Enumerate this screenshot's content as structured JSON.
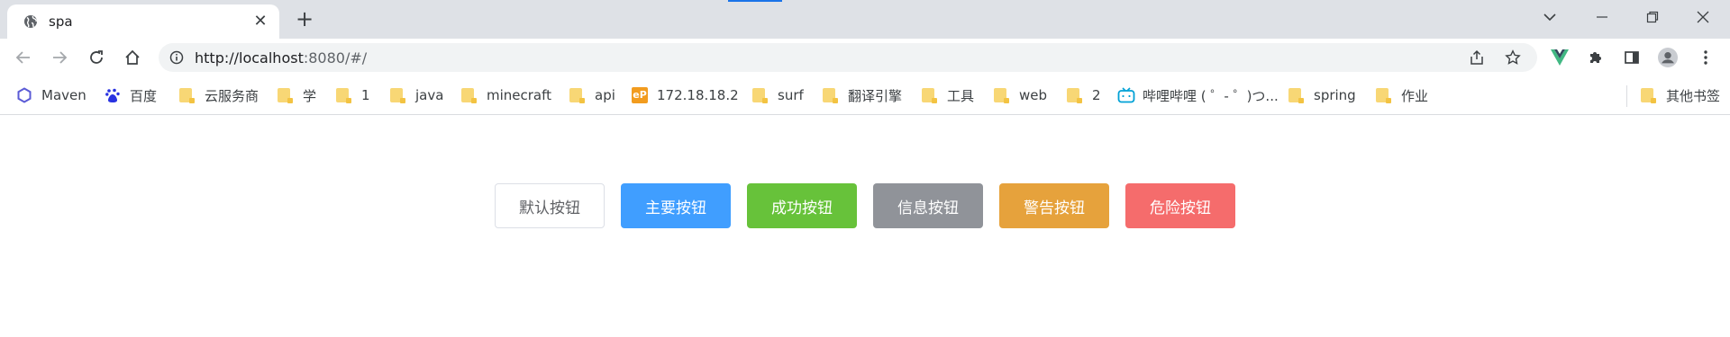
{
  "browser": {
    "tab": {
      "title": "spa",
      "close_glyph": "✕",
      "favicon": "globe-icon"
    },
    "new_tab_glyph": "+",
    "window_controls": [
      "chevron-down-icon",
      "minimize-icon",
      "restore-icon",
      "close-icon"
    ],
    "address": {
      "url_host": "http://localhost",
      "url_rest": ":8080/#/"
    },
    "extensions": [
      "vue-devtools-icon",
      "puzzle-icon",
      "side-panel-icon",
      "profile-icon",
      "more-icon"
    ]
  },
  "bookmarks": [
    {
      "label": "Maven",
      "icon": "maven-icon"
    },
    {
      "label": "百度",
      "icon": "baidu-icon"
    },
    {
      "label": "云服务商",
      "icon": "folder-icon"
    },
    {
      "label": "学",
      "icon": "folder-icon"
    },
    {
      "label": "1",
      "icon": "folder-icon"
    },
    {
      "label": "java",
      "icon": "folder-icon"
    },
    {
      "label": "minecraft",
      "icon": "folder-icon"
    },
    {
      "label": "api",
      "icon": "folder-icon"
    },
    {
      "label": "172.18.18.2",
      "icon": "ep-icon",
      "icon_text": "eP"
    },
    {
      "label": "surf",
      "icon": "folder-icon"
    },
    {
      "label": "翻译引擎",
      "icon": "folder-icon"
    },
    {
      "label": "工具",
      "icon": "folder-icon"
    },
    {
      "label": "web",
      "icon": "folder-icon"
    },
    {
      "label": "2",
      "icon": "folder-icon"
    },
    {
      "label": "哔哩哔哩 ( ゜- ゜)つ...",
      "icon": "bilibili-icon"
    },
    {
      "label": "spring",
      "icon": "folder-icon"
    },
    {
      "label": "作业",
      "icon": "folder-icon"
    }
  ],
  "other_bookmarks": {
    "label": "其他书签",
    "icon": "folder-icon"
  },
  "buttons": {
    "default": "默认按钮",
    "primary": "主要按钮",
    "success": "成功按钮",
    "info": "信息按钮",
    "warning": "警告按钮",
    "danger": "危险按钮"
  },
  "colors": {
    "primary": "#409eff",
    "success": "#67c23a",
    "info": "#909399",
    "warning": "#e6a23c",
    "danger": "#f56c6c"
  }
}
